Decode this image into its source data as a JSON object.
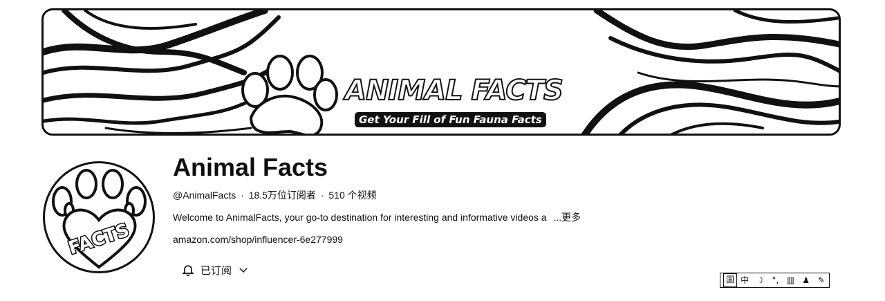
{
  "banner": {
    "title": "ANIMAL FACTS",
    "subtitle": "Get Your Fill of Fun Fauna Facts"
  },
  "avatar": {
    "text": "FACTS"
  },
  "channel": {
    "name": "Animal Facts",
    "handle": "@AnimalFacts",
    "separator": "·",
    "subscribers": "18.5万位订阅者",
    "videos": "510 个视频",
    "description": "Welcome to AnimalFacts, your go-to destination for interesting and informative videos a",
    "more_label": "...更多",
    "link": "amazon.com/shop/influencer-6e277999"
  },
  "subscribe": {
    "label": "已订阅",
    "icon": "bell-icon",
    "chevron": "chevron-down-icon"
  },
  "ime_toolbar": {
    "items": [
      "国",
      "中",
      "☽",
      "°,",
      "▥",
      "♟",
      "✎"
    ]
  }
}
